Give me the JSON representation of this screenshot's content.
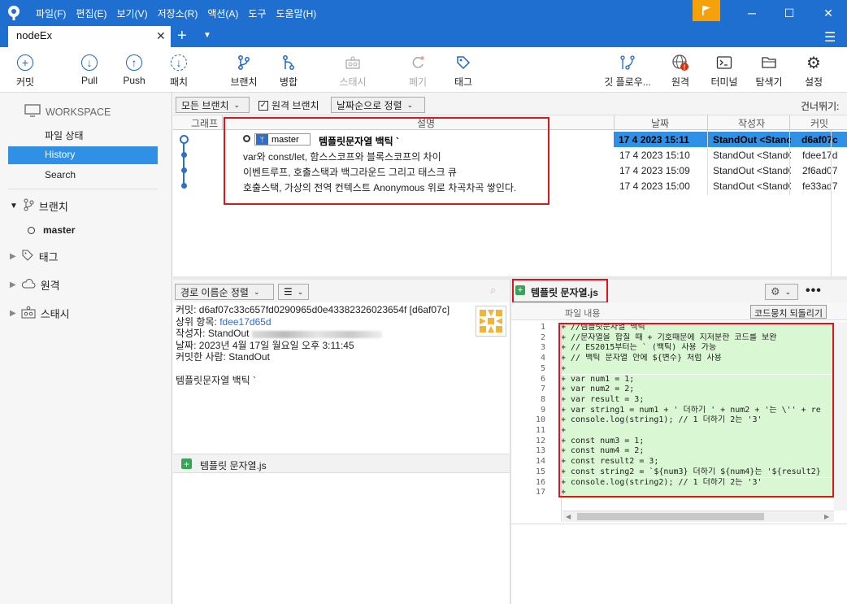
{
  "menu": [
    "파일(F)",
    "편집(E)",
    "보기(V)",
    "저장소(R)",
    "액션(A)",
    "도구",
    "도움말(H)"
  ],
  "tab": {
    "title": "nodeEx",
    "close": "✕",
    "plus": "+"
  },
  "toolbar": {
    "commit": "커밋",
    "pull": "Pull",
    "push": "Push",
    "fetch": "패치",
    "branch": "브랜치",
    "merge": "병합",
    "stash": "스태시",
    "discard": "폐기",
    "tag": "태그",
    "gitflow": "깃 플로우...",
    "remote": "원격",
    "terminal": "터미널",
    "explorer": "탐색기",
    "settings": "설정"
  },
  "sidebar": {
    "workspace": "WORKSPACE",
    "items": [
      "파일 상태",
      "History",
      "Search"
    ],
    "groups": {
      "branches": "브랜치",
      "tags": "태그",
      "remotes": "원격",
      "stashes": "스태시"
    },
    "branch": "master"
  },
  "history": {
    "filter_branch": "모든 브랜치",
    "remote_branch": "원격 브랜치",
    "sort": "날짜순으로 정렬",
    "skip": "건너뛰기:",
    "columns": {
      "graph": "그래프",
      "desc": "설명",
      "date": "날짜",
      "author": "작성자",
      "commit": "커밋"
    },
    "branch_label": "master",
    "rows": [
      {
        "desc": "템플릿문자열 백틱 `",
        "date": "17 4 2023 15:11",
        "author": "StandOut <Stanc",
        "commit": "d6af07c"
      },
      {
        "desc": "var와 const/let, 함스스코프와 블록스코프의 차이",
        "date": "17 4 2023 15:10",
        "author": "StandOut <StandC",
        "commit": "fdee17d"
      },
      {
        "desc": "이벤트루프, 호출스택과 백그라운드 그리고 태스크 큐",
        "date": "17 4 2023 15:09",
        "author": "StandOut <StandC",
        "commit": "2f6ad07"
      },
      {
        "desc": "호출스택, 가상의 전역 컨텍스트 Anonymous 위로 차곡차곡 쌓인다.",
        "date": "17 4 2023 15:00",
        "author": "StandOut <StandC",
        "commit": "fe33ad7"
      }
    ]
  },
  "lower": {
    "sort_path": "경로 이름순 정렬",
    "commit_label": "커밋:",
    "commit_value": "d6af07c33c657fd0290965d0e43382326023654f [d6af07c]",
    "parent_label": "상위 항목:",
    "parent_value": "fdee17d65d",
    "author_label": "작성자:",
    "author_value": "StandOut",
    "date_label": "날짜:",
    "date_value": "2023년 4월 17일 월요일 오후 3:11:45",
    "committer_label": "커밋한 사람:",
    "committer_value": "StandOut",
    "message": "템플릿문자열 백틱 `",
    "file": "템플릿 문자열.js"
  },
  "diff": {
    "file": "템플릿 문자열.js",
    "sub": "파일 내용",
    "revert": "코드뭉치 되돌리기",
    "line_numbers": [
      "1",
      "2",
      "3",
      "4",
      "5",
      "6",
      "7",
      "8",
      "9",
      "10",
      "11",
      "12",
      "13",
      "14",
      "15",
      "16",
      "17"
    ],
    "lines": [
      "+ //템플릿문자열 백틱 `",
      "+ //문자열을 합칠 때 + 기호때문에 지저분한 코드를 보완",
      "+ // ES2015부터는 ` (백틱) 사용 가능",
      "+ // 백틱 문자열 안에 ${변수} 처럼 사용",
      "+",
      "+ var num1 = 1;",
      "+ var num2 = 2;",
      "+ var result = 3;",
      "+ var string1 = num1 + ' 더하기 ' + num2 + '는 \\'' + re",
      "+ console.log(string1); // 1 더하기 2는 '3'",
      "+",
      "+ const num3 = 1;",
      "+ const num4 = 2;",
      "+ const result2 = 3;",
      "+ const string2 = `${num3} 더하기 ${num4}는 '${result2}",
      "+ console.log(string2); // 1 더하기 2는 '3'",
      "+"
    ]
  }
}
